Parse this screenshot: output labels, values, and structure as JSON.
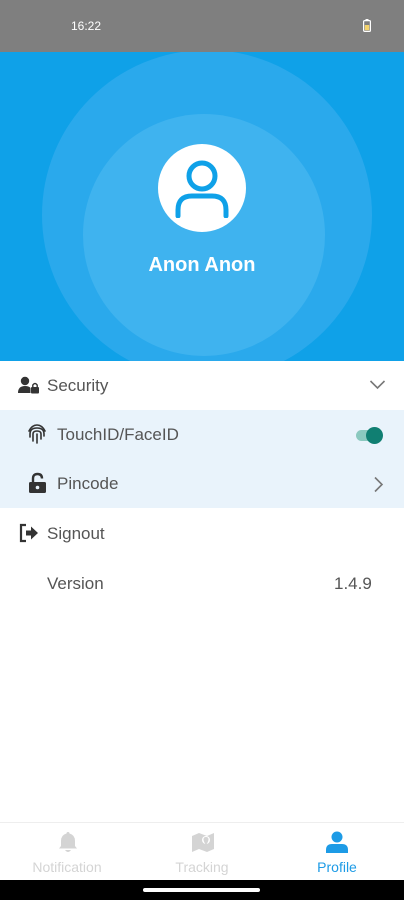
{
  "status_bar": {
    "time": "16:22"
  },
  "profile": {
    "name": "Anon Anon"
  },
  "settings": {
    "security_label": "Security",
    "touchid_label": "TouchID/FaceID",
    "touchid_enabled": true,
    "pincode_label": "Pincode",
    "signout_label": "Signout",
    "version_label": "Version",
    "version_value": "1.4.9"
  },
  "tabs": [
    {
      "label": "Notification",
      "icon": "bell-icon",
      "active": false
    },
    {
      "label": "Tracking",
      "icon": "map-icon",
      "active": false
    },
    {
      "label": "Profile",
      "icon": "user-icon",
      "active": true
    }
  ],
  "colors": {
    "header": "#0fa1e8",
    "active_tab": "#1d9be6",
    "toggle": "#107f72",
    "sub_row_bg": "#e9f3fb"
  }
}
